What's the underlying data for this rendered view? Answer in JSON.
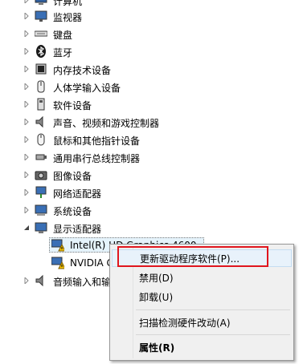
{
  "tree": {
    "categories": [
      {
        "label": "计算机",
        "icon": "computer-icon"
      },
      {
        "label": "监视器",
        "icon": "monitor-icon"
      },
      {
        "label": "键盘",
        "icon": "keyboard-icon"
      },
      {
        "label": "蓝牙",
        "icon": "bluetooth-icon"
      },
      {
        "label": "内存技术设备",
        "icon": "memory-icon"
      },
      {
        "label": "人体学输入设备",
        "icon": "hid-icon"
      },
      {
        "label": "软件设备",
        "icon": "software-device-icon"
      },
      {
        "label": "声音、视频和游戏控制器",
        "icon": "speaker-icon"
      },
      {
        "label": "鼠标和其他指针设备",
        "icon": "mouse-icon"
      },
      {
        "label": "通用串行总线控制器",
        "icon": "usb-icon"
      },
      {
        "label": "图像设备",
        "icon": "camera-icon"
      },
      {
        "label": "网络适配器",
        "icon": "network-icon"
      },
      {
        "label": "系统设备",
        "icon": "system-icon"
      },
      {
        "label": "显示适配器",
        "icon": "display-adapter-icon"
      }
    ],
    "display_children": [
      {
        "label": "Intel(R) HD Graphics 4600",
        "icon": "display-warning-icon"
      },
      {
        "label": "NVIDIA GeForce GT 740M",
        "icon": "display-warning-icon"
      }
    ],
    "last_category": {
      "label": "音频输入和输出",
      "icon": "audio-io-icon"
    }
  },
  "context_menu": {
    "update_driver": "更新驱动程序软件(P)...",
    "disable": "禁用(D)",
    "uninstall": "卸载(U)",
    "scan_hardware": "扫描检测硬件改动(A)",
    "properties": "属性(R)"
  },
  "colors": {
    "highlight_border": "#e0161e",
    "menu_bg": "#f0f0f0",
    "selection_bg": "#e5f3fb"
  }
}
